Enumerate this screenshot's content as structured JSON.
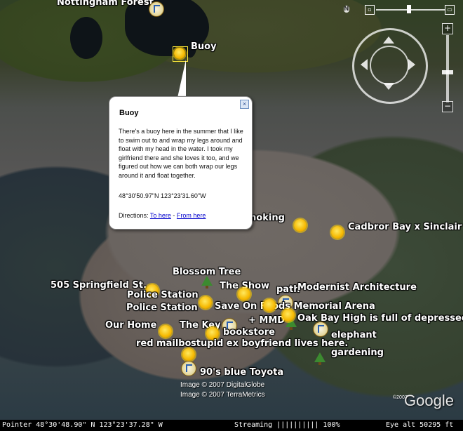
{
  "map": {
    "places": [
      {
        "name": "Nottingham Forest",
        "icon": "pushpin-icon"
      },
      {
        "name": "Buoy",
        "icon": "sun-icon"
      },
      {
        "name": "smoking",
        "icon": "sun-icon"
      },
      {
        "name": "Cadbror Bay x Sinclair",
        "icon": "sun-icon"
      },
      {
        "name": "Blossom Tree",
        "icon": "tree-icon"
      },
      {
        "name": "505 Springfield St.",
        "icon": "sun-icon"
      },
      {
        "name": "The Show",
        "icon": "sun-icon"
      },
      {
        "name": "path",
        "icon": "pushpin-icon"
      },
      {
        "name": "Modernist Architecture",
        "icon": "sun-icon"
      },
      {
        "name": "Police Station",
        "icon": "sun-icon"
      },
      {
        "name": "Police Station",
        "icon": "sun-icon"
      },
      {
        "name": "Save On Foods Memorial Arena",
        "icon": "sun-icon"
      },
      {
        "name": "+ MMD",
        "icon": "tree-icon"
      },
      {
        "name": "Oak Bay High is full of depressed teens",
        "icon": "sun-icon"
      },
      {
        "name": "Our Home",
        "icon": "sun-icon"
      },
      {
        "name": "The Key",
        "icon": "pushpin-icon"
      },
      {
        "name": "bookstore",
        "icon": "pushpin-icon"
      },
      {
        "name": "elephant",
        "icon": "flag-icon"
      },
      {
        "name": "red mailbox",
        "icon": "sun-icon"
      },
      {
        "name": "stupid ex boyfriend lives here.",
        "icon": "sun-icon"
      },
      {
        "name": "gardening",
        "icon": "tree-icon"
      },
      {
        "name": "90's blue Toyota",
        "icon": "pushpin-icon"
      }
    ]
  },
  "balloon": {
    "title": "Buoy",
    "body": "There's a buoy here in the summer that I like to swim out to and wrap my legs around and float with my head in the water. I took my girlfriend there and she loves it too, and we figured out how we can both wrap our legs around it and float together.",
    "coords": "48°30'50.97\"N 123°23'31.60\"W",
    "directions_label": "Directions:",
    "to_here": "To here",
    "separator": "-",
    "from_here": "From here",
    "close": "×"
  },
  "nav": {
    "north": "N",
    "zoom_in": "+",
    "zoom_out": "−"
  },
  "copyright": {
    "line1": "Image © 2007 DigitalGlobe",
    "line2": "Image © 2007 TerraMetrics",
    "logo": "Google",
    "logo_prefix": "©2007"
  },
  "status": {
    "pointer": "Pointer 48°30'48.90\" N 123°23'37.28\" W",
    "streaming": "Streaming |||||||||| 100%",
    "eye_alt": "Eye alt     50295 ft"
  }
}
